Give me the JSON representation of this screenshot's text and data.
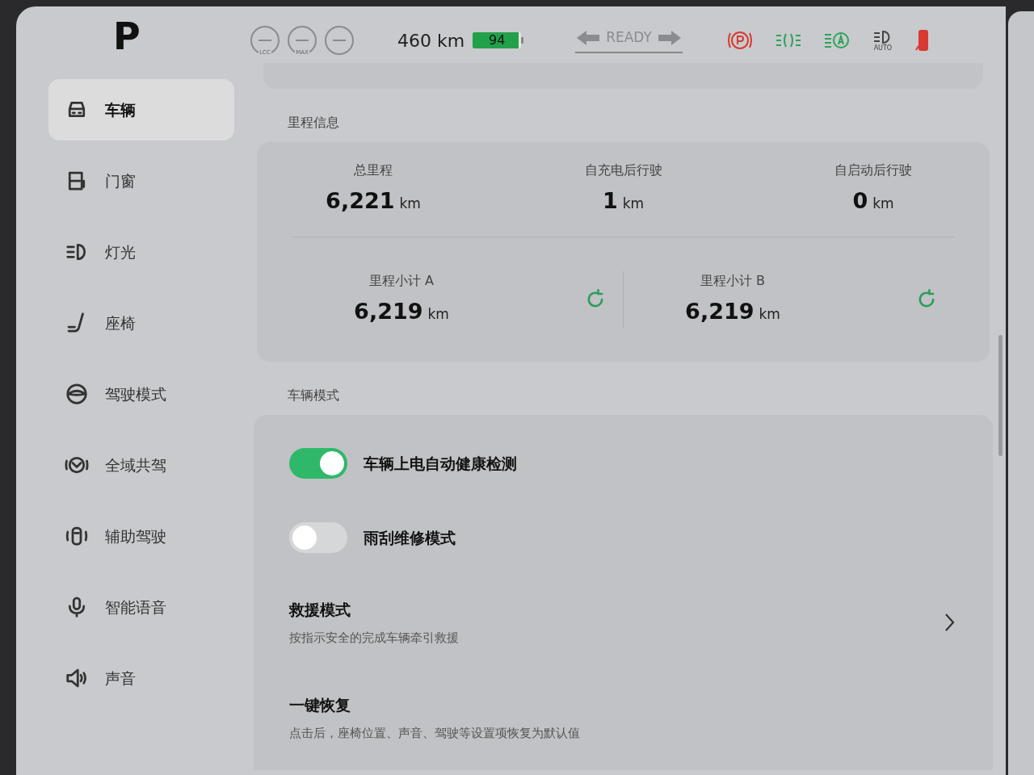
{
  "gear": "P",
  "status_bar": {
    "assist": [
      {
        "kind": "labeled",
        "label": "LCC"
      },
      {
        "kind": "labeled",
        "label": "MAX"
      },
      {
        "kind": "plain"
      }
    ],
    "range": "460 km",
    "battery": {
      "percent": "94",
      "level": 0.94
    },
    "ready": "READY",
    "auto_label": "AUTO"
  },
  "sidebar": {
    "items": [
      {
        "label": "车辆",
        "selected": true
      },
      {
        "label": "门窗",
        "selected": false
      },
      {
        "label": "灯光",
        "selected": false
      },
      {
        "label": "座椅",
        "selected": false
      },
      {
        "label": "驾驶模式",
        "selected": false
      },
      {
        "label": "全域共驾",
        "selected": false
      },
      {
        "label": "辅助驾驶",
        "selected": false
      },
      {
        "label": "智能语音",
        "selected": false
      },
      {
        "label": "声音",
        "selected": false
      }
    ]
  },
  "mileage": {
    "title": "里程信息",
    "totals": [
      {
        "label": "总里程",
        "value": "6,221",
        "unit": "km"
      },
      {
        "label": "自充电后行驶",
        "value": "1",
        "unit": "km"
      },
      {
        "label": "自启动后行驶",
        "value": "0",
        "unit": "km"
      }
    ],
    "trips": [
      {
        "label": "里程小计 A",
        "value": "6,219",
        "unit": "km"
      },
      {
        "label": "里程小计 B",
        "value": "6,219",
        "unit": "km"
      }
    ]
  },
  "vehicle_mode": {
    "title": "车辆模式",
    "items": [
      {
        "kind": "toggle",
        "label": "车辆上电自动健康检测",
        "on": true
      },
      {
        "kind": "toggle",
        "label": "雨刮维修模式",
        "on": false
      },
      {
        "kind": "link",
        "title": "救援模式",
        "description": "按指示安全的完成车辆牵引救援"
      },
      {
        "kind": "action",
        "title": "一键恢复",
        "description": "点击后，座椅位置、声音、驾驶等设置项恢复为默认值"
      }
    ]
  }
}
